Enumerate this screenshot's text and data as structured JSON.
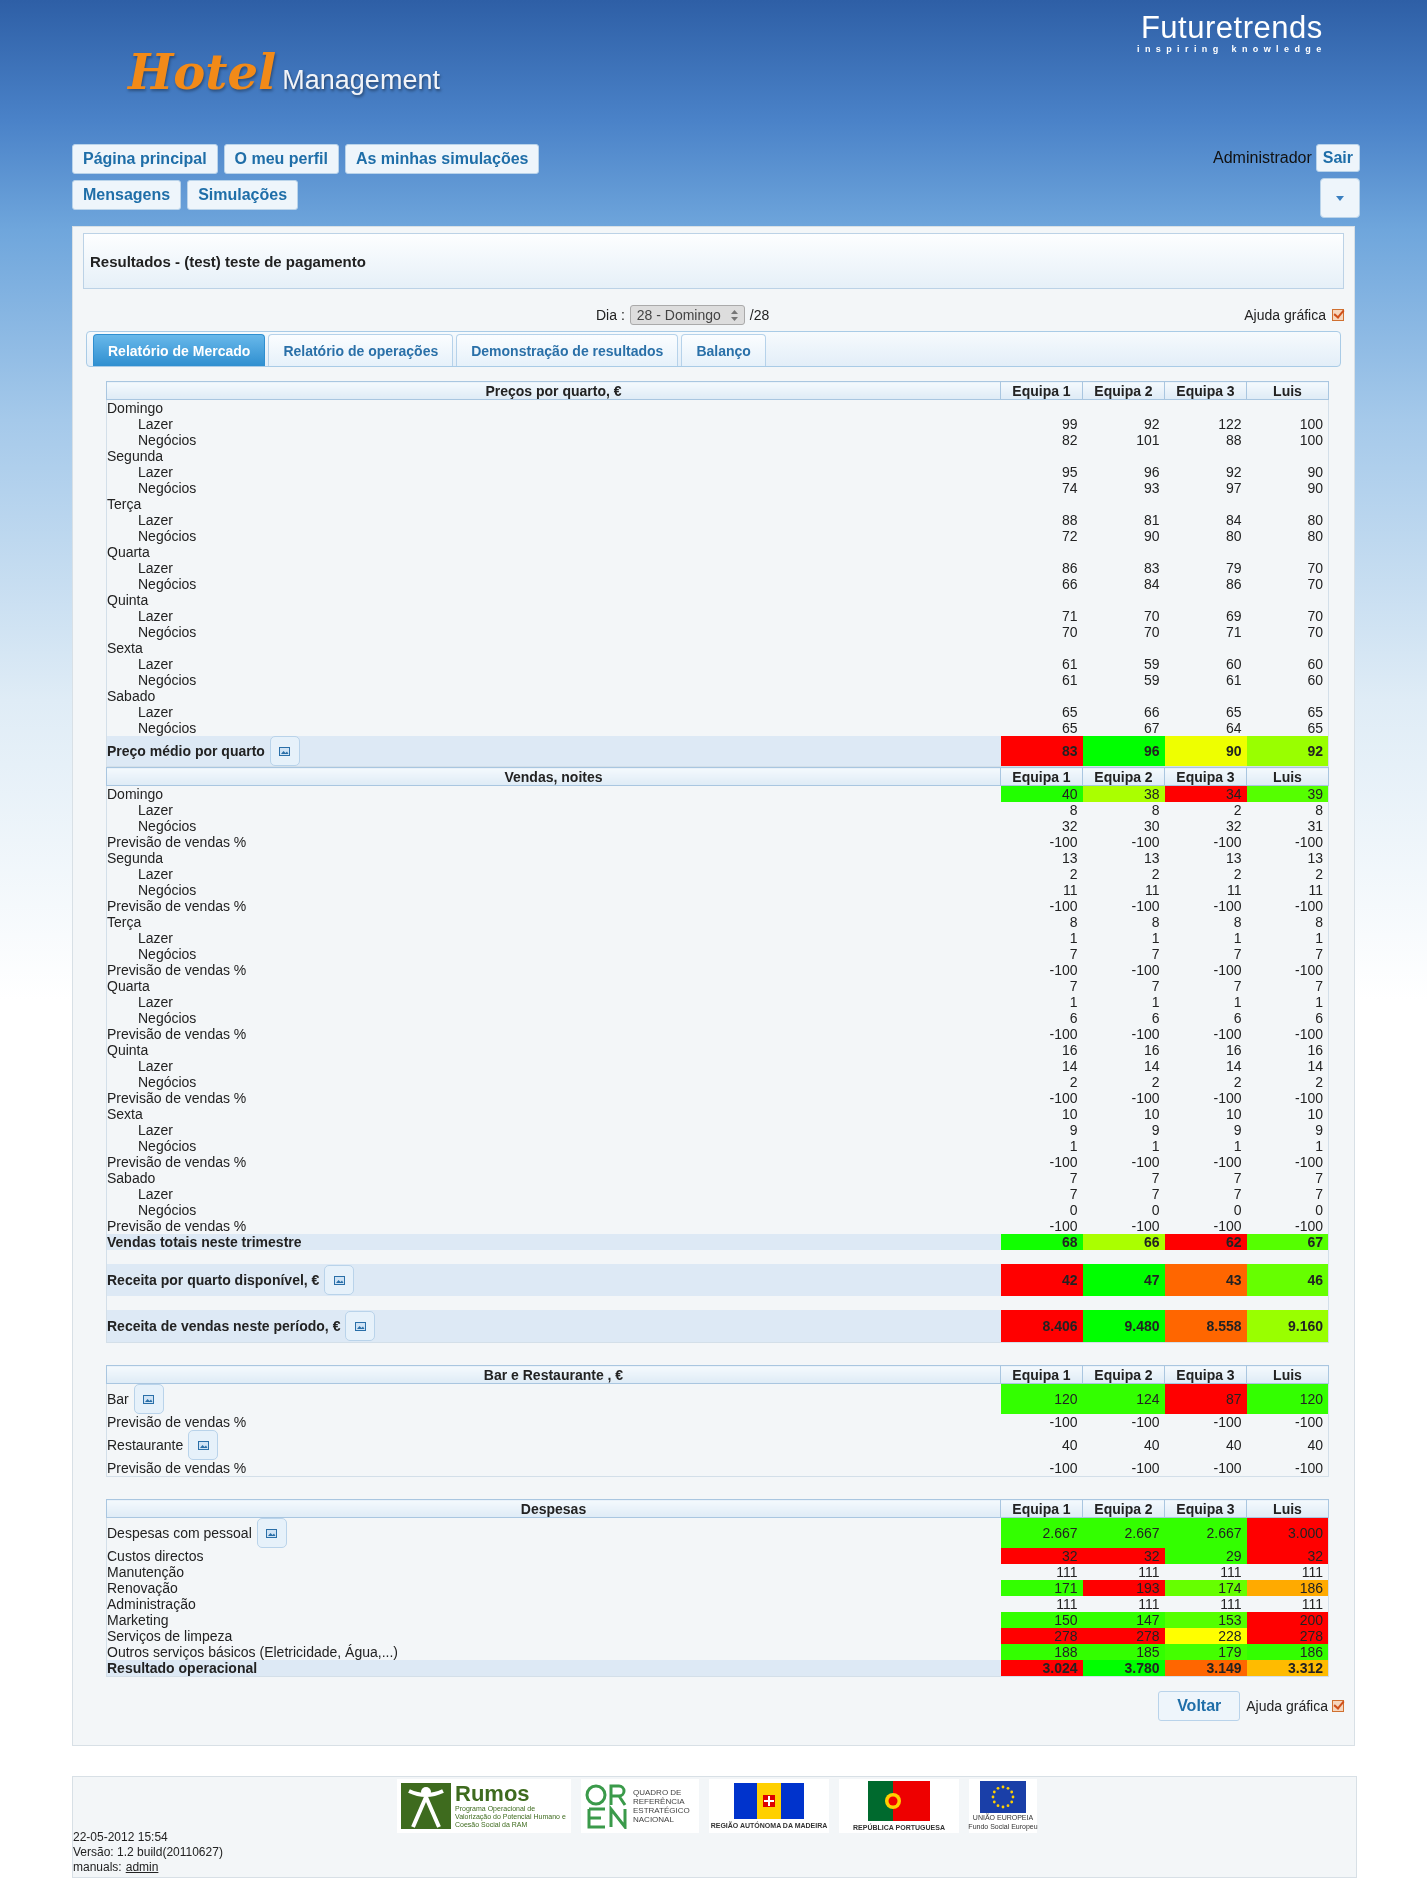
{
  "header": {
    "logo_main": "Hotel",
    "logo_sub": "Management",
    "brand": "Futuretrends",
    "brand_tagline": "inspiring knowledge"
  },
  "nav_rows": [
    [
      "Página principal",
      "O meu perfil",
      "As minhas simulações"
    ],
    [
      "Mensagens",
      "Simulações"
    ]
  ],
  "user": {
    "name": "Administrador",
    "logout": "Sair"
  },
  "page_title": "Resultados - (test) teste de pagamento",
  "day_selector": {
    "label": "Dia :",
    "value": "28 - Domingo",
    "total": "/28"
  },
  "help_toggle_top": {
    "label": "Ajuda gráfica",
    "checked": true
  },
  "tabs": [
    {
      "label": "Relatório de Mercado",
      "selected": true
    },
    {
      "label": "Relatório de operações",
      "selected": false
    },
    {
      "label": "Demonstração de resultados",
      "selected": false
    },
    {
      "label": "Balanço",
      "selected": false
    }
  ],
  "sections": [
    {
      "title": "Preços por quarto, €",
      "columns": [
        "Equipa 1",
        "Equipa 2",
        "Equipa 3",
        "Luis"
      ],
      "rows": [
        {
          "kind": "plain",
          "label": "Domingo"
        },
        {
          "kind": "indent",
          "label": "Lazer",
          "cells": [
            "99",
            "92",
            "122",
            "100"
          ]
        },
        {
          "kind": "indent",
          "label": "Negócios",
          "cells": [
            "82",
            "101",
            "88",
            "100"
          ]
        },
        {
          "kind": "plain",
          "label": "Segunda"
        },
        {
          "kind": "indent",
          "label": "Lazer",
          "cells": [
            "95",
            "96",
            "92",
            "90"
          ]
        },
        {
          "kind": "indent",
          "label": "Negócios",
          "cells": [
            "74",
            "93",
            "97",
            "90"
          ]
        },
        {
          "kind": "plain",
          "label": "Terça"
        },
        {
          "kind": "indent",
          "label": "Lazer",
          "cells": [
            "88",
            "81",
            "84",
            "80"
          ]
        },
        {
          "kind": "indent",
          "label": "Negócios",
          "cells": [
            "72",
            "90",
            "80",
            "80"
          ]
        },
        {
          "kind": "plain",
          "label": "Quarta"
        },
        {
          "kind": "indent",
          "label": "Lazer",
          "cells": [
            "86",
            "83",
            "79",
            "70"
          ]
        },
        {
          "kind": "indent",
          "label": "Negócios",
          "cells": [
            "66",
            "84",
            "86",
            "70"
          ]
        },
        {
          "kind": "plain",
          "label": "Quinta"
        },
        {
          "kind": "indent",
          "label": "Lazer",
          "cells": [
            "71",
            "70",
            "69",
            "70"
          ]
        },
        {
          "kind": "indent",
          "label": "Negócios",
          "cells": [
            "70",
            "70",
            "71",
            "70"
          ]
        },
        {
          "kind": "plain",
          "label": "Sexta"
        },
        {
          "kind": "indent",
          "label": "Lazer",
          "cells": [
            "61",
            "59",
            "60",
            "60"
          ]
        },
        {
          "kind": "indent",
          "label": "Negócios",
          "cells": [
            "61",
            "59",
            "61",
            "60"
          ]
        },
        {
          "kind": "plain",
          "label": "Sabado"
        },
        {
          "kind": "indent",
          "label": "Lazer",
          "cells": [
            "65",
            "66",
            "65",
            "65"
          ]
        },
        {
          "kind": "indent",
          "label": "Negócios",
          "cells": [
            "65",
            "67",
            "64",
            "65"
          ]
        },
        {
          "kind": "summary",
          "label": "Preço médio por quarto",
          "chart_button": true,
          "cells": [
            {
              "value": "83",
              "color": "#ff0000"
            },
            {
              "value": "96",
              "color": "#00ff00"
            },
            {
              "value": "90",
              "color": "#eeff00"
            },
            {
              "value": "92",
              "color": "#99ff00"
            }
          ]
        }
      ]
    },
    {
      "title": "Vendas, noites",
      "columns": [
        "Equipa 1",
        "Equipa 2",
        "Equipa 3",
        "Luis"
      ],
      "rows": [
        {
          "kind": "plain",
          "label": "Domingo",
          "cells": [
            {
              "value": "40",
              "color": "#22ff00"
            },
            {
              "value": "38",
              "color": "#aaff00"
            },
            {
              "value": "34",
              "color": "#ff0000"
            },
            {
              "value": "39",
              "color": "#55ff00"
            }
          ]
        },
        {
          "kind": "indent",
          "label": "Lazer",
          "cells": [
            "8",
            "8",
            "2",
            "8"
          ]
        },
        {
          "kind": "indent",
          "label": "Negócios",
          "cells": [
            "32",
            "30",
            "32",
            "31"
          ]
        },
        {
          "kind": "plain",
          "label": "Previsão de vendas %",
          "cells": [
            "-100",
            "-100",
            "-100",
            "-100"
          ]
        },
        {
          "kind": "plain",
          "label": "Segunda",
          "cells": [
            "13",
            "13",
            "13",
            "13"
          ]
        },
        {
          "kind": "indent",
          "label": "Lazer",
          "cells": [
            "2",
            "2",
            "2",
            "2"
          ]
        },
        {
          "kind": "indent",
          "label": "Negócios",
          "cells": [
            "11",
            "11",
            "11",
            "11"
          ]
        },
        {
          "kind": "plain",
          "label": "Previsão de vendas %",
          "cells": [
            "-100",
            "-100",
            "-100",
            "-100"
          ]
        },
        {
          "kind": "plain",
          "label": "Terça",
          "cells": [
            "8",
            "8",
            "8",
            "8"
          ]
        },
        {
          "kind": "indent",
          "label": "Lazer",
          "cells": [
            "1",
            "1",
            "1",
            "1"
          ]
        },
        {
          "kind": "indent",
          "label": "Negócios",
          "cells": [
            "7",
            "7",
            "7",
            "7"
          ]
        },
        {
          "kind": "plain",
          "label": "Previsão de vendas %",
          "cells": [
            "-100",
            "-100",
            "-100",
            "-100"
          ]
        },
        {
          "kind": "plain",
          "label": "Quarta",
          "cells": [
            "7",
            "7",
            "7",
            "7"
          ]
        },
        {
          "kind": "indent",
          "label": "Lazer",
          "cells": [
            "1",
            "1",
            "1",
            "1"
          ]
        },
        {
          "kind": "indent",
          "label": "Negócios",
          "cells": [
            "6",
            "6",
            "6",
            "6"
          ]
        },
        {
          "kind": "plain",
          "label": "Previsão de vendas %",
          "cells": [
            "-100",
            "-100",
            "-100",
            "-100"
          ]
        },
        {
          "kind": "plain",
          "label": "Quinta",
          "cells": [
            "16",
            "16",
            "16",
            "16"
          ]
        },
        {
          "kind": "indent",
          "label": "Lazer",
          "cells": [
            "14",
            "14",
            "14",
            "14"
          ]
        },
        {
          "kind": "indent",
          "label": "Negócios",
          "cells": [
            "2",
            "2",
            "2",
            "2"
          ]
        },
        {
          "kind": "plain",
          "label": "Previsão de vendas %",
          "cells": [
            "-100",
            "-100",
            "-100",
            "-100"
          ]
        },
        {
          "kind": "plain",
          "label": "Sexta",
          "cells": [
            "10",
            "10",
            "10",
            "10"
          ]
        },
        {
          "kind": "indent",
          "label": "Lazer",
          "cells": [
            "9",
            "9",
            "9",
            "9"
          ]
        },
        {
          "kind": "indent",
          "label": "Negócios",
          "cells": [
            "1",
            "1",
            "1",
            "1"
          ]
        },
        {
          "kind": "plain",
          "label": "Previsão de vendas %",
          "cells": [
            "-100",
            "-100",
            "-100",
            "-100"
          ]
        },
        {
          "kind": "plain",
          "label": "Sabado",
          "cells": [
            "7",
            "7",
            "7",
            "7"
          ]
        },
        {
          "kind": "indent",
          "label": "Lazer",
          "cells": [
            "7",
            "7",
            "7",
            "7"
          ]
        },
        {
          "kind": "indent",
          "label": "Negócios",
          "cells": [
            "0",
            "0",
            "0",
            "0"
          ]
        },
        {
          "kind": "plain",
          "label": "Previsão de vendas %",
          "cells": [
            "-100",
            "-100",
            "-100",
            "-100"
          ]
        },
        {
          "kind": "summary",
          "label": "Vendas totais neste trimestre",
          "cells": [
            {
              "value": "68",
              "color": "#11ff00"
            },
            {
              "value": "66",
              "color": "#aaff00"
            },
            {
              "value": "62",
              "color": "#ff0000"
            },
            {
              "value": "67",
              "color": "#55ff00"
            }
          ]
        },
        {
          "kind": "metric",
          "label": "Receita por quarto disponível, €",
          "chart_button": true,
          "cells": [
            {
              "value": "42",
              "color": "#ff0000"
            },
            {
              "value": "47",
              "color": "#00ff00"
            },
            {
              "value": "43",
              "color": "#ff6600"
            },
            {
              "value": "46",
              "color": "#66ff00"
            }
          ]
        },
        {
          "kind": "metric",
          "label": "Receita de vendas neste período, €",
          "chart_button": true,
          "cells": [
            {
              "value": "8.406",
              "color": "#ff0000"
            },
            {
              "value": "9.480",
              "color": "#00ff00"
            },
            {
              "value": "8.558",
              "color": "#ff6600"
            },
            {
              "value": "9.160",
              "color": "#99ff00"
            }
          ]
        }
      ]
    },
    {
      "title": "Bar e Restaurante , €",
      "columns": [
        "Equipa 1",
        "Equipa 2",
        "Equipa 3",
        "Luis"
      ],
      "rows": [
        {
          "kind": "plain",
          "label": "Bar",
          "chart_button": true,
          "cells": [
            {
              "value": "120",
              "color": "#33ff00"
            },
            {
              "value": "124",
              "color": "#33ff00"
            },
            {
              "value": "87",
              "color": "#ff0000"
            },
            {
              "value": "120",
              "color": "#33ff00"
            }
          ]
        },
        {
          "kind": "plain",
          "label": "Previsão de vendas %",
          "cells": [
            "-100",
            "-100",
            "-100",
            "-100"
          ]
        },
        {
          "kind": "plain",
          "label": "Restaurante",
          "chart_button": true,
          "cells": [
            "40",
            "40",
            "40",
            "40"
          ]
        },
        {
          "kind": "plain",
          "label": "Previsão de vendas %",
          "cells": [
            "-100",
            "-100",
            "-100",
            "-100"
          ]
        }
      ]
    },
    {
      "title": "Despesas",
      "columns": [
        "Equipa 1",
        "Equipa 2",
        "Equipa 3",
        "Luis"
      ],
      "rows": [
        {
          "kind": "plain",
          "label": "Despesas com pessoal",
          "chart_button": true,
          "cells": [
            {
              "value": "2.667",
              "color": "#33ff00"
            },
            {
              "value": "2.667",
              "color": "#33ff00"
            },
            {
              "value": "2.667",
              "color": "#33ff00"
            },
            {
              "value": "3.000",
              "color": "#ff0000"
            }
          ]
        },
        {
          "kind": "plain",
          "label": "Custos directos",
          "cells": [
            {
              "value": "32",
              "color": "#ff0000"
            },
            {
              "value": "32",
              "color": "#ff0000"
            },
            {
              "value": "29",
              "color": "#33ff00"
            },
            {
              "value": "32",
              "color": "#ff0000"
            }
          ]
        },
        {
          "kind": "plain",
          "label": "Manutenção",
          "cells": [
            "111",
            "111",
            "111",
            "111"
          ]
        },
        {
          "kind": "plain",
          "label": "Renovação",
          "cells": [
            {
              "value": "171",
              "color": "#33ff00"
            },
            {
              "value": "193",
              "color": "#ff0000"
            },
            {
              "value": "174",
              "color": "#66ff00"
            },
            {
              "value": "186",
              "color": "#ffaa00"
            }
          ]
        },
        {
          "kind": "plain",
          "label": "Administração",
          "cells": [
            "111",
            "111",
            "111",
            "111"
          ]
        },
        {
          "kind": "plain",
          "label": "Marketing",
          "cells": [
            {
              "value": "150",
              "color": "#33ff00"
            },
            {
              "value": "147",
              "color": "#33ff00"
            },
            {
              "value": "153",
              "color": "#55ff00"
            },
            {
              "value": "200",
              "color": "#ff0000"
            }
          ]
        },
        {
          "kind": "plain",
          "label": "Serviços de limpeza",
          "cells": [
            {
              "value": "278",
              "color": "#ff0000"
            },
            {
              "value": "278",
              "color": "#ff0000"
            },
            {
              "value": "228",
              "color": "#ffff00"
            },
            {
              "value": "278",
              "color": "#ff0000"
            }
          ]
        },
        {
          "kind": "plain",
          "label": "Outros serviços básicos (Eletricidade, Água,...)",
          "cells": [
            {
              "value": "188",
              "color": "#33ff00"
            },
            {
              "value": "185",
              "color": "#33ff00"
            },
            {
              "value": "179",
              "color": "#44ff00"
            },
            {
              "value": "186",
              "color": "#33ff00"
            }
          ]
        },
        {
          "kind": "summary",
          "label": "Resultado operacional",
          "cells": [
            {
              "value": "3.024",
              "color": "#ff0000"
            },
            {
              "value": "3.780",
              "color": "#00ff00"
            },
            {
              "value": "3.149",
              "color": "#ff6600"
            },
            {
              "value": "3.312",
              "color": "#ffbb00"
            }
          ]
        }
      ]
    }
  ],
  "back_button": "Voltar",
  "help_toggle_bottom": {
    "label": "Ajuda gráfica",
    "checked": true
  },
  "footer": {
    "logos": {
      "rumos_name": "Rumos",
      "rumos_text": "Programa Operacional de Valorização do Potencial Humano e Coesão Social da RAM",
      "qren_text": "QUADRO DE REFERÊNCIA ESTRATÉGICO NACIONAL",
      "madeira": "REGIÃO AUTÓNOMA DA MADEIRA",
      "portugal": "REPÚBLICA PORTUGUESA",
      "eu": "UNIÃO EUROPEIA",
      "eu_fund": "Fundo Social Europeu"
    },
    "timestamp": "22-05-2012 15:54",
    "version": "Versão: 1.2 build(20110627)",
    "manuals_label": "manuals:",
    "manuals_link": "admin"
  }
}
